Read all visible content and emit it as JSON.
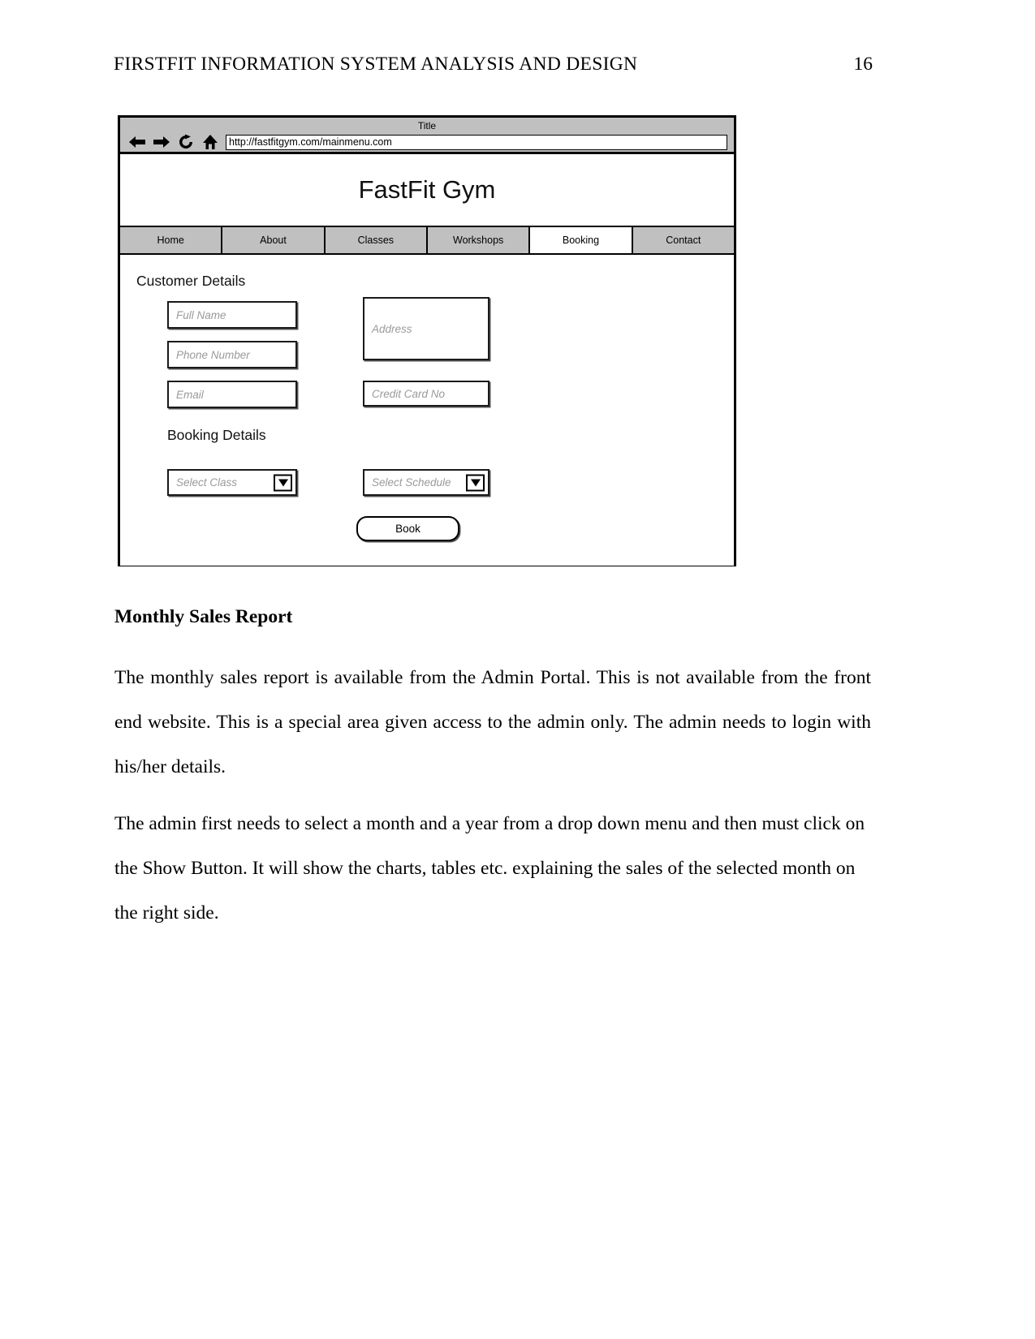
{
  "document": {
    "running_head": "FIRSTFIT INFORMATION SYSTEM ANALYSIS AND DESIGN",
    "page_number": "16"
  },
  "mockup": {
    "browser": {
      "window_title": "Title",
      "url": "http://fastfitgym.com/mainmenu.com",
      "icons": {
        "back": "back-arrow-icon",
        "forward": "forward-arrow-icon",
        "reload": "reload-icon",
        "home": "home-icon"
      }
    },
    "site": {
      "title": "FastFit Gym",
      "nav": [
        {
          "label": "Home",
          "active": false
        },
        {
          "label": "About",
          "active": false
        },
        {
          "label": "Classes",
          "active": false
        },
        {
          "label": "Workshops",
          "active": false
        },
        {
          "label": "Booking",
          "active": true
        },
        {
          "label": "Contact",
          "active": false
        }
      ]
    },
    "form": {
      "customer_heading": "Customer Details",
      "booking_heading": "Booking Details",
      "full_name_placeholder": "Full Name",
      "phone_placeholder": "Phone Number",
      "email_placeholder": "Email",
      "address_placeholder": "Address",
      "credit_card_placeholder": "Credit Card No",
      "select_class_placeholder": "Select Class",
      "select_schedule_placeholder": "Select Schedule",
      "book_button_label": "Book"
    }
  },
  "content": {
    "heading": "Monthly Sales Report",
    "paragraph_1": "The monthly sales report is available from the Admin Portal. This is not available from the front end website. This is a special area given access to the admin only. The admin needs to login with his/her details.",
    "paragraph_2": "The admin first needs to select a month and a year from a drop down menu and then must click on the Show Button. It will show the charts, tables etc. explaining the sales of the selected month on the right side."
  }
}
